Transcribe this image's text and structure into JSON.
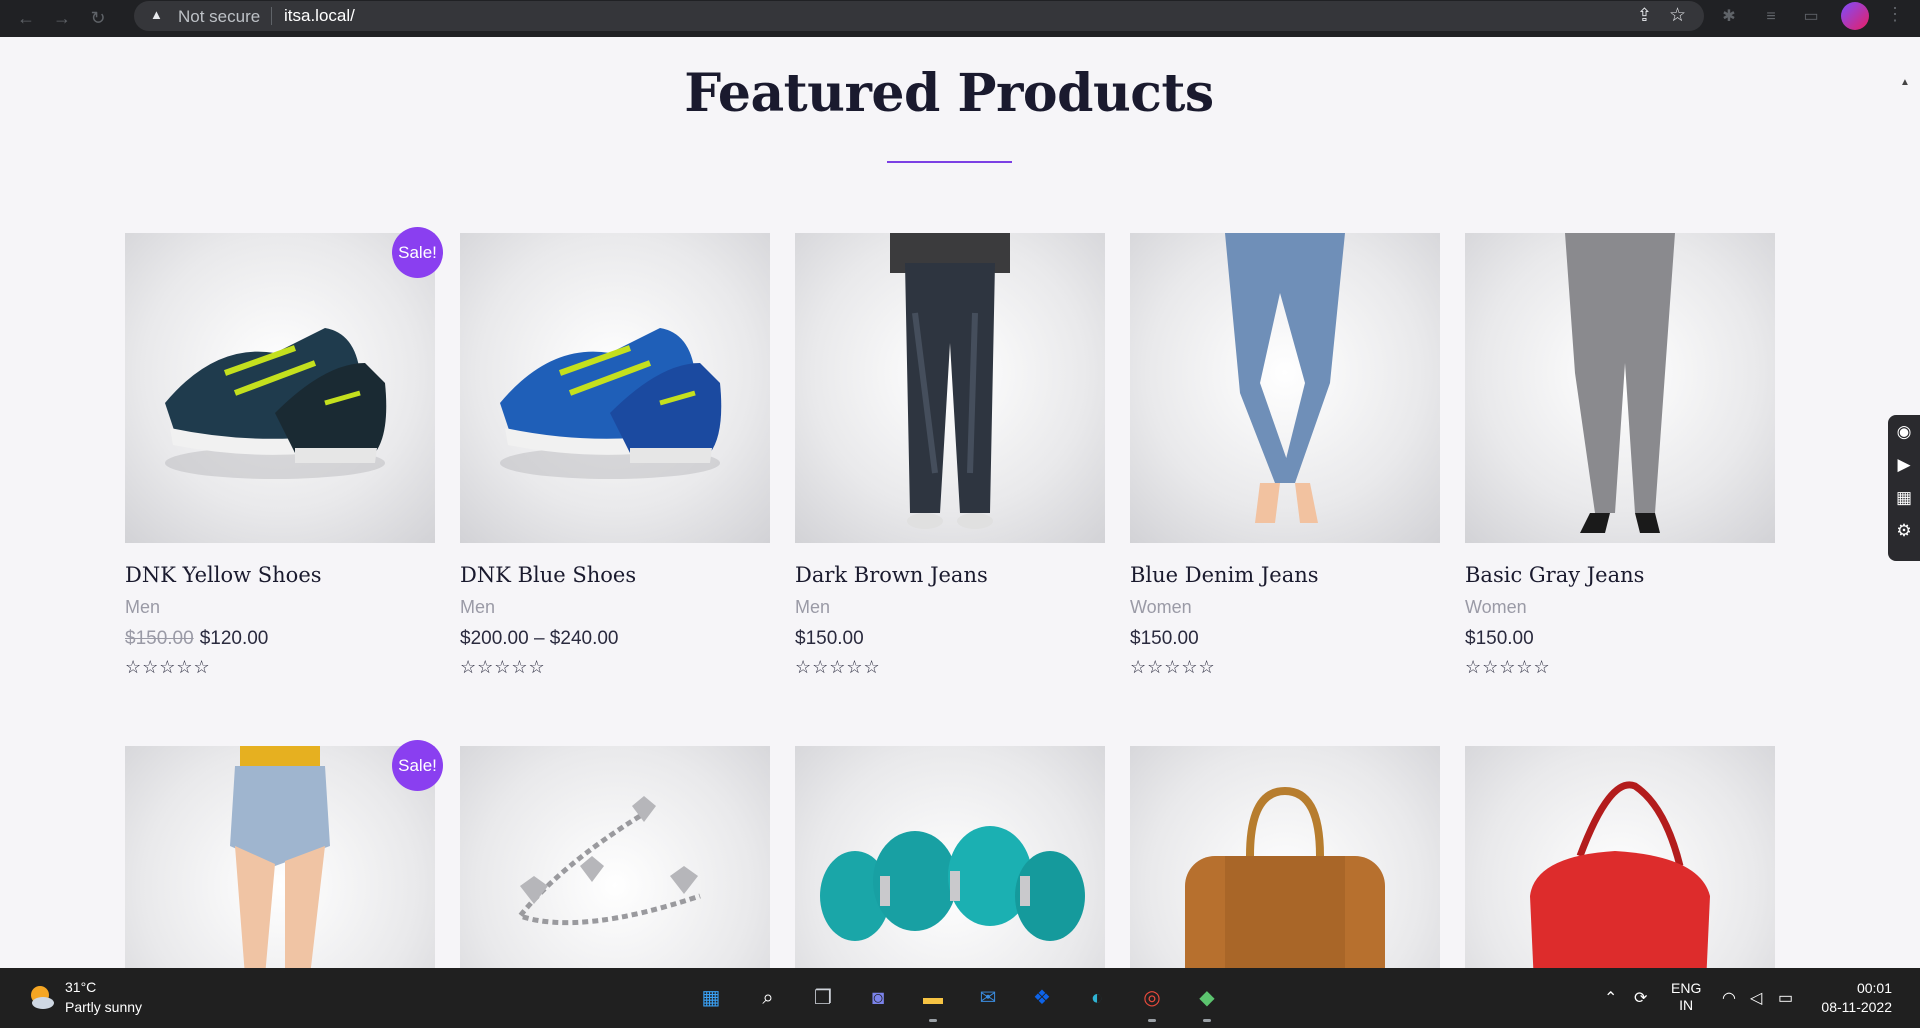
{
  "browser": {
    "security_label": "Not secure",
    "url": "itsa.local/"
  },
  "page": {
    "heading": "Featured Products"
  },
  "products": [
    {
      "name": "DNK Yellow Shoes",
      "category": "Men",
      "old_price": "$150.00",
      "price": "$120.00",
      "sale": "Sale!",
      "rating": "☆☆☆☆☆",
      "image": "yellow-shoes"
    },
    {
      "name": "DNK Blue Shoes",
      "category": "Men",
      "old_price": "",
      "price": "$200.00 – $240.00",
      "sale": "",
      "rating": "☆☆☆☆☆",
      "image": "blue-shoes"
    },
    {
      "name": "Dark Brown Jeans",
      "category": "Men",
      "old_price": "",
      "price": "$150.00",
      "sale": "",
      "rating": "☆☆☆☆☆",
      "image": "dark-jeans"
    },
    {
      "name": "Blue Denim Jeans",
      "category": "Women",
      "old_price": "",
      "price": "$150.00",
      "sale": "",
      "rating": "☆☆☆☆☆",
      "image": "blue-jeans"
    },
    {
      "name": "Basic Gray Jeans",
      "category": "Women",
      "old_price": "",
      "price": "$150.00",
      "sale": "",
      "rating": "☆☆☆☆☆",
      "image": "gray-jeans"
    },
    {
      "name": "",
      "category": "",
      "old_price": "",
      "price": "",
      "sale": "Sale!",
      "rating": "",
      "image": "denim-shorts"
    },
    {
      "name": "",
      "category": "",
      "old_price": "",
      "price": "",
      "sale": "",
      "rating": "",
      "image": "silver-bracelet"
    },
    {
      "name": "",
      "category": "",
      "old_price": "",
      "price": "",
      "sale": "",
      "rating": "",
      "image": "turquoise-bracelet"
    },
    {
      "name": "",
      "category": "",
      "old_price": "",
      "price": "",
      "sale": "",
      "rating": "",
      "image": "brown-bag"
    },
    {
      "name": "",
      "category": "",
      "old_price": "",
      "price": "",
      "sale": "",
      "rating": "",
      "image": "red-bag"
    }
  ],
  "taskbar": {
    "weather_temp": "31°C",
    "weather_desc": "Partly sunny",
    "lang_1": "ENG",
    "lang_2": "IN",
    "time": "00:01",
    "date": "08-11-2022"
  },
  "colors": {
    "accent": "#8a3ff0",
    "heading_line": "#7b3fe4",
    "taskbar": "#202020"
  }
}
